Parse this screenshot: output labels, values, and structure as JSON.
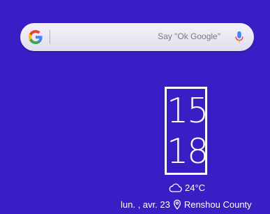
{
  "search": {
    "hint": "Say \"Ok Google\""
  },
  "clock": {
    "hours": "15",
    "minutes": "18"
  },
  "weather": {
    "temperature": "24°C"
  },
  "date": {
    "text": "lun. , avr. 23",
    "location": "Renshou County"
  },
  "colors": {
    "background": "#3a1dc4",
    "search_bar": "#eeebf6"
  },
  "icons": {
    "google": "google-g-icon",
    "mic": "mic-icon",
    "weather": "cloud-icon",
    "location": "location-pin-icon"
  }
}
